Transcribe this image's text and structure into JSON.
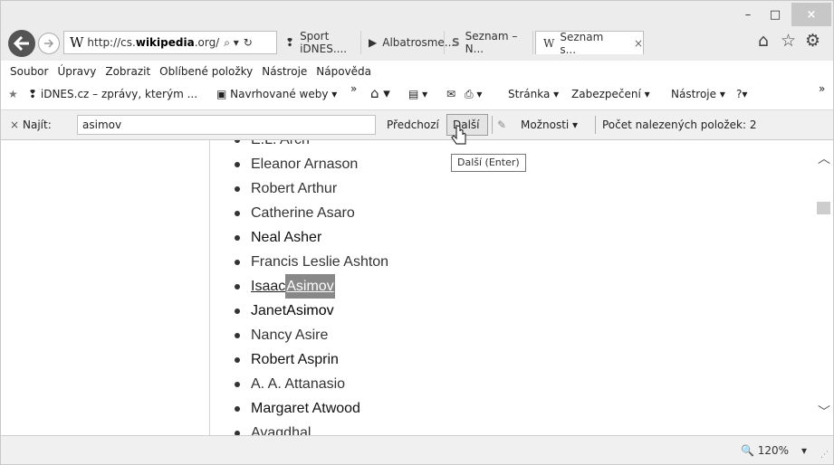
{
  "window_controls": {
    "minimize": "–",
    "maximize": "□",
    "close": "×"
  },
  "address": {
    "site_logo": "W",
    "url_prefix": "http://cs.",
    "url_domain": "wikipedia",
    "url_suffix": ".org/",
    "search_icon": "⌕ ▾",
    "refresh_icon": "↻"
  },
  "tabs": [
    {
      "icon": "❢",
      "label": "Sport iDNES...."
    },
    {
      "icon": "▶",
      "label": "Albatrosme..."
    },
    {
      "icon": "S",
      "label": "Seznam – N..."
    },
    {
      "icon": "W",
      "label": "Seznam s...",
      "close": "×"
    }
  ],
  "toolbar_icons": {
    "home": "⌂",
    "favorites": "☆",
    "settings": "⚙"
  },
  "menu": [
    "Soubor",
    "Úpravy",
    "Zobrazit",
    "Oblíbené položky",
    "Nástroje",
    "Nápověda"
  ],
  "favorites_bar": {
    "item1": "iDNES.cz – zprávy, kterým ...",
    "item2": "Navrhované weby ▾",
    "overflow": "»",
    "stranka": "Stránka ▾",
    "zabezpeceni": "Zabezpečení ▾",
    "nastroje": "Nástroje ▾",
    "help": "?▾",
    "more": "»"
  },
  "findbar": {
    "close": "×",
    "label": "Najít:",
    "value": "asimov",
    "prev": "Předchozí",
    "next": "Další",
    "options": "Možnosti ▾",
    "count": "Počet nalezených položek: 2"
  },
  "tooltip": "Další (Enter)",
  "list": [
    {
      "text": "E.L. Arch"
    },
    {
      "text": "Eleanor Arnason"
    },
    {
      "text": "Robert Arthur"
    },
    {
      "text": "Catherine Asaro"
    },
    {
      "text": "Neal Asher"
    },
    {
      "text": "Francis Leslie Ashton"
    },
    {
      "pre": "Isaac ",
      "match": "Asimov"
    },
    {
      "pre": "Janet ",
      "match": "Asimov"
    },
    {
      "text": "Nancy Asire"
    },
    {
      "text": "Robert Asprin"
    },
    {
      "text": "A. A. Attanasio"
    },
    {
      "text": "Margaret Atwood"
    },
    {
      "text": "Avaqdhal"
    }
  ],
  "status": {
    "zoom": "🔍 120%",
    "zoom_dropdown": "▾"
  }
}
